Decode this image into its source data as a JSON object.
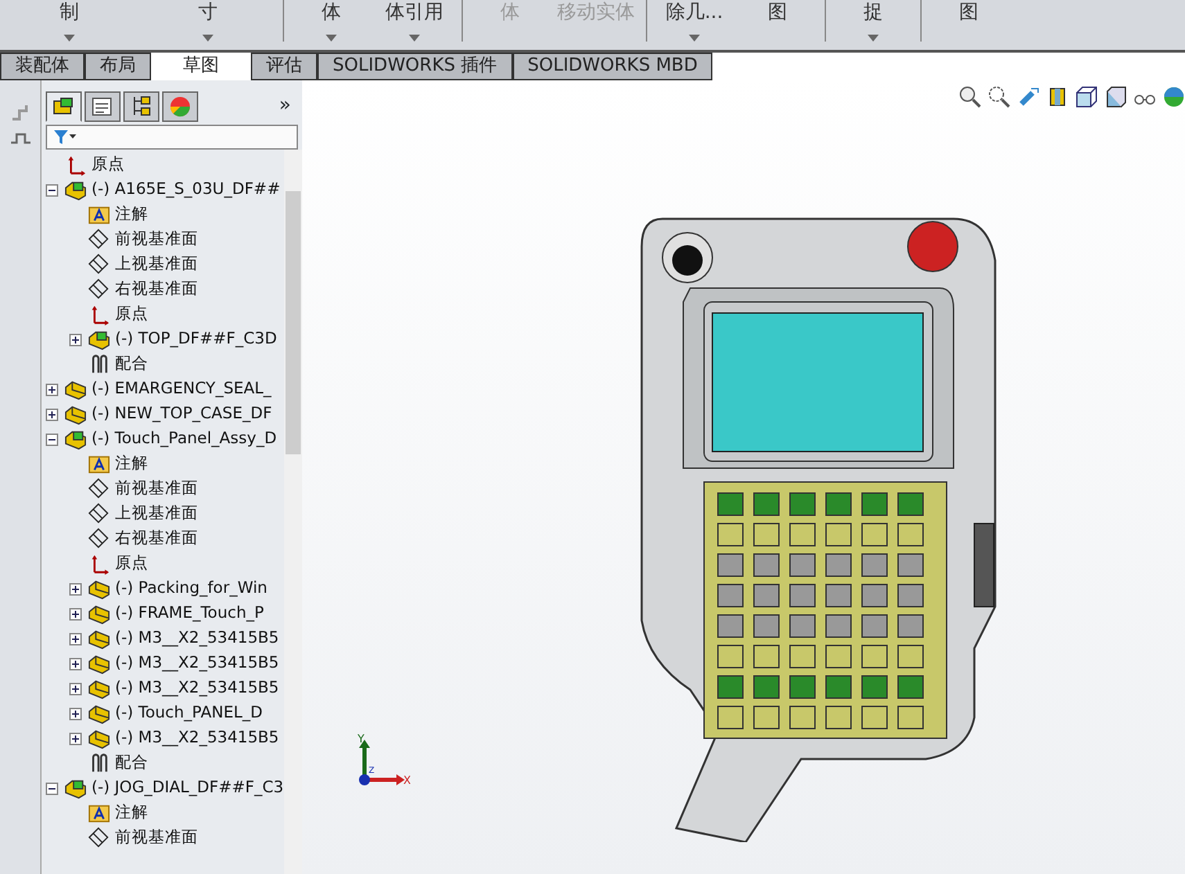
{
  "ribbon": {
    "buttons": [
      {
        "label": "制",
        "has_caret": true
      },
      {
        "label": "寸",
        "has_caret": true
      },
      {
        "label": "体",
        "has_caret": true
      },
      {
        "label": "体引用",
        "has_caret": true
      },
      {
        "label": "体",
        "has_caret": false
      },
      {
        "label": "移动实体",
        "has_caret": false
      },
      {
        "label": "除几...",
        "has_caret": true
      },
      {
        "label": "图",
        "has_caret": false
      },
      {
        "label": "捉",
        "has_caret": true
      },
      {
        "label": "图",
        "has_caret": false
      }
    ]
  },
  "tabs": [
    {
      "label": "装配体",
      "selected": false
    },
    {
      "label": "布局",
      "selected": false
    },
    {
      "label": "草图",
      "selected": true
    },
    {
      "label": "评估",
      "selected": false
    },
    {
      "label": "SOLIDWORKS 插件",
      "selected": false
    },
    {
      "label": "SOLIDWORKS MBD",
      "selected": false
    }
  ],
  "panel_chevron": "»",
  "panel_tabs": [
    {
      "kind": "tree",
      "selected": true
    },
    {
      "kind": "property",
      "selected": false
    },
    {
      "kind": "config",
      "selected": false
    },
    {
      "kind": "display",
      "selected": false
    }
  ],
  "tree": [
    {
      "kind": "origin",
      "label": "原点"
    },
    {
      "kind": "assembly",
      "label": "(-) A165E_S_03U_DF##",
      "expanded": true,
      "children": [
        {
          "kind": "note",
          "label": "注解"
        },
        {
          "kind": "plane",
          "label": "前视基准面"
        },
        {
          "kind": "plane",
          "label": "上视基准面"
        },
        {
          "kind": "plane",
          "label": "右视基准面"
        },
        {
          "kind": "origin",
          "label": "原点"
        },
        {
          "kind": "assembly",
          "label": "(-) TOP_DF##F_C3D",
          "expanded": false
        },
        {
          "kind": "mates",
          "label": "配合"
        }
      ]
    },
    {
      "kind": "part",
      "label": "(-) EMARGENCY_SEAL_",
      "expanded": false
    },
    {
      "kind": "part",
      "label": "(-) NEW_TOP_CASE_DF",
      "expanded": false
    },
    {
      "kind": "assembly",
      "label": "(-) Touch_Panel_Assy_D",
      "expanded": true,
      "children": [
        {
          "kind": "note",
          "label": "注解"
        },
        {
          "kind": "plane",
          "label": "前视基准面"
        },
        {
          "kind": "plane",
          "label": "上视基准面"
        },
        {
          "kind": "plane",
          "label": "右视基准面"
        },
        {
          "kind": "origin",
          "label": "原点"
        },
        {
          "kind": "part",
          "label": "(-) Packing_for_Win",
          "expanded": false
        },
        {
          "kind": "part",
          "label": "(-) FRAME_Touch_P",
          "expanded": false
        },
        {
          "kind": "part",
          "label": "(-) M3__X2_53415B5",
          "expanded": false
        },
        {
          "kind": "part",
          "label": "(-) M3__X2_53415B5",
          "expanded": false
        },
        {
          "kind": "part",
          "label": "(-) M3__X2_53415B5",
          "expanded": false
        },
        {
          "kind": "part",
          "label": "(-) Touch_PANEL_D",
          "expanded": false
        },
        {
          "kind": "part",
          "label": "(-) M3__X2_53415B5",
          "expanded": false
        },
        {
          "kind": "mates",
          "label": "配合"
        }
      ]
    },
    {
      "kind": "assembly",
      "label": "(-) JOG_DIAL_DF##F_C3",
      "expanded": true,
      "children": [
        {
          "kind": "note",
          "label": "注解"
        },
        {
          "kind": "plane",
          "label": "前视基准面"
        }
      ]
    }
  ],
  "triad": {
    "x_label": "X",
    "y_label": "Y",
    "z_label": "Z"
  }
}
